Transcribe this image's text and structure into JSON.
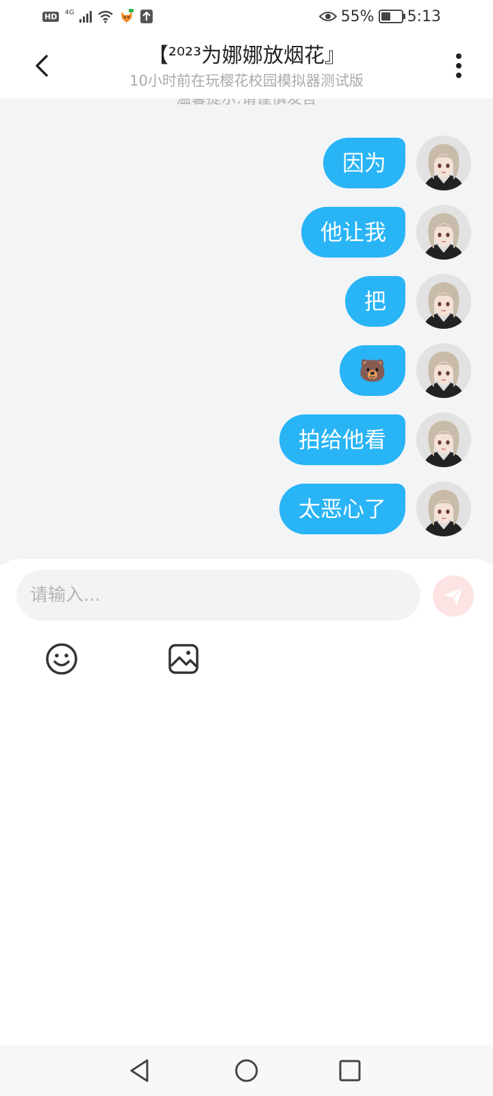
{
  "status_bar": {
    "hd": "HD",
    "network": "4G",
    "battery_percent": "55%",
    "time": "5:13",
    "battery_level": 0.55
  },
  "header": {
    "title": "【²⁰²³为娜娜放烟花』",
    "subtitle": "10小时前在玩樱花校园模拟器测试版"
  },
  "chat": {
    "notice": "温馨提示:请谨慎发言",
    "messages": [
      {
        "text": "因为"
      },
      {
        "text": "他让我"
      },
      {
        "text": "把"
      },
      {
        "text": "🐻"
      },
      {
        "text": "拍给他看"
      },
      {
        "text": "太恶心了"
      }
    ]
  },
  "composer": {
    "placeholder": "请输入..."
  },
  "colors": {
    "accent": "#29b4f6",
    "send_button": "#fde3e3",
    "chat_background": "#f3f4f6"
  },
  "icons": {
    "back": "chevron-left-icon",
    "more": "more-vertical-icon",
    "send": "paper-plane-icon",
    "emoji": "smiley-icon",
    "image": "image-icon",
    "nav_back": "triangle-back-icon",
    "nav_home": "circle-home-icon",
    "nav_recents": "square-recents-icon"
  }
}
